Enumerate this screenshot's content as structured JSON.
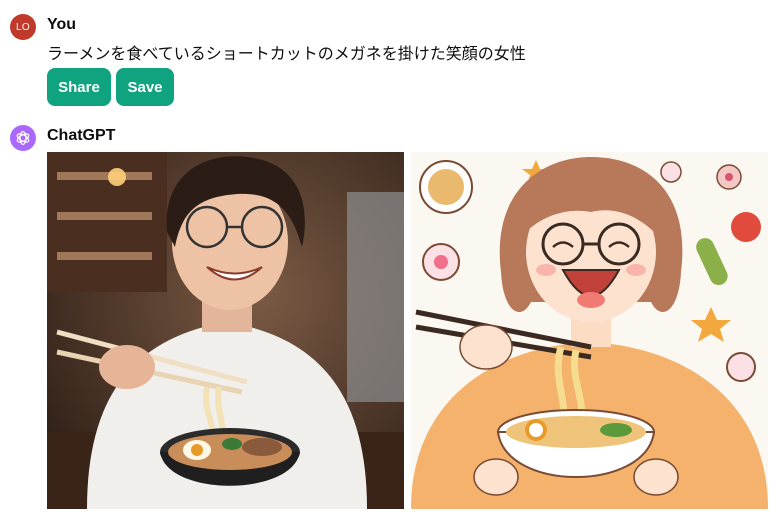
{
  "user_message": {
    "avatar_initials": "LO",
    "author": "You",
    "text": "ラーメンを食べているショートカットのメガネを掛けた笑顔の女性",
    "buttons": {
      "share_label": "Share",
      "save_label": "Save"
    }
  },
  "assistant_message": {
    "author": "ChatGPT",
    "avatar_icon": "openai-logo-icon",
    "images": [
      {
        "name": "generated-image-photo"
      },
      {
        "name": "generated-image-illustration"
      }
    ]
  },
  "colors": {
    "accent": "#10a37f",
    "user_avatar": "#c0392b",
    "bot_avatar": "#ab68ff"
  }
}
